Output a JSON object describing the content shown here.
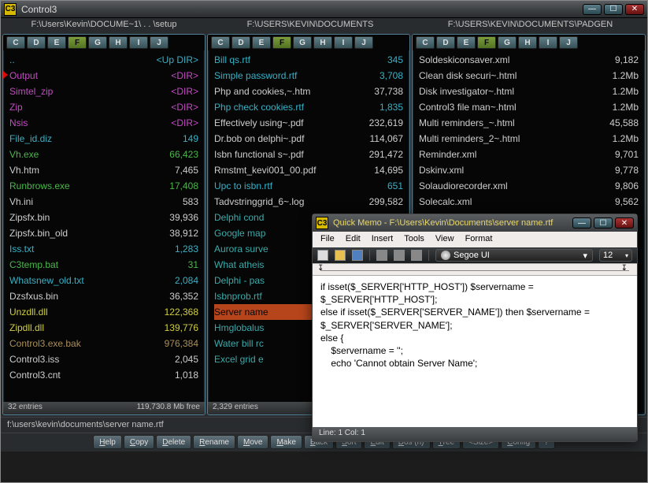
{
  "app": {
    "title": "Control3"
  },
  "paths": {
    "p1": "F:\\Users\\Kevin\\DOCUME~1\\ . . \\setup",
    "p2": "F:\\USERS\\KEVIN\\DOCUMENTS",
    "p3": "F:\\USERS\\KEVIN\\DOCUMENTS\\PADGEN"
  },
  "drives": [
    "C",
    "D",
    "E",
    "F",
    "G",
    "H",
    "I",
    "J"
  ],
  "drive_active": "F",
  "panel1": {
    "files": [
      {
        "name": "..",
        "size": "<Up DIR>",
        "c": "c-cyan"
      },
      {
        "name": "Output",
        "size": "<DIR>",
        "c": "c-mag",
        "marked": true
      },
      {
        "name": "Simtel_zip",
        "size": "<DIR>",
        "c": "c-mag"
      },
      {
        "name": "Zip",
        "size": "<DIR>",
        "c": "c-mag"
      },
      {
        "name": "Nsis",
        "size": "<DIR>",
        "c": "c-mag"
      },
      {
        "name": "File_id.diz",
        "size": "149",
        "c": "c-cyan"
      },
      {
        "name": "Vh.exe",
        "size": "66,423",
        "c": "c-green"
      },
      {
        "name": "Vh.htm",
        "size": "7,465",
        "c": "c-white"
      },
      {
        "name": "Runbrows.exe",
        "size": "17,408",
        "c": "c-green"
      },
      {
        "name": "Vh.ini",
        "size": "583",
        "c": "c-white"
      },
      {
        "name": "Zipsfx.bin",
        "size": "39,936",
        "c": "c-white"
      },
      {
        "name": "Zipsfx.bin_old",
        "size": "38,912",
        "c": "c-white"
      },
      {
        "name": "Iss.txt",
        "size": "1,283",
        "c": "c-cyan"
      },
      {
        "name": "C3temp.bat",
        "size": "31",
        "c": "c-green"
      },
      {
        "name": "Whatsnew_old.txt",
        "size": "2,084",
        "c": "c-cyan"
      },
      {
        "name": "Dzsfxus.bin",
        "size": "36,352",
        "c": "c-white"
      },
      {
        "name": "Unzdll.dll",
        "size": "122,368",
        "c": "c-yellow"
      },
      {
        "name": "Zipdll.dll",
        "size": "139,776",
        "c": "c-yellow"
      },
      {
        "name": "Control3.exe.bak",
        "size": "976,384",
        "c": "c-tan"
      },
      {
        "name": "Control3.iss",
        "size": "2,045",
        "c": "c-white"
      },
      {
        "name": "Control3.cnt",
        "size": "1,018",
        "c": "c-white"
      }
    ],
    "status_left": "32 entries",
    "status_right": "119,730.8 Mb free"
  },
  "panel2": {
    "files": [
      {
        "name": "Bill qs.rtf",
        "size": "345",
        "c": "c-cyan"
      },
      {
        "name": "Simple password.rtf",
        "size": "3,708",
        "c": "c-cyan"
      },
      {
        "name": "Php and cookies,~.htm",
        "size": "37,738",
        "c": "c-white"
      },
      {
        "name": "Php check cookies.rtf",
        "size": "1,835",
        "c": "c-cyan"
      },
      {
        "name": "Effectively using~.pdf",
        "size": "232,619",
        "c": "c-white"
      },
      {
        "name": "Dr.bob on delphi~.pdf",
        "size": "114,067",
        "c": "c-white"
      },
      {
        "name": "Isbn functional s~.pdf",
        "size": "291,472",
        "c": "c-white"
      },
      {
        "name": "Rmstmt_kevi001_00.pdf",
        "size": "14,695",
        "c": "c-white"
      },
      {
        "name": "Upc to isbn.rtf",
        "size": "651",
        "c": "c-cyan"
      },
      {
        "name": "Tadvstringgrid_6~.log",
        "size": "299,582",
        "c": "c-white"
      },
      {
        "name": "Delphi cond",
        "size": "",
        "c": "c-teal"
      },
      {
        "name": "Google map",
        "size": "",
        "c": "c-teal"
      },
      {
        "name": "Aurora surve",
        "size": "",
        "c": "c-teal"
      },
      {
        "name": "What atheis",
        "size": "",
        "c": "c-teal"
      },
      {
        "name": "Delphi - pas",
        "size": "",
        "c": "c-teal"
      },
      {
        "name": "Isbnprob.rtf",
        "size": "",
        "c": "c-teal"
      },
      {
        "name": "Server name",
        "size": "",
        "c": "c-white",
        "sel": true
      },
      {
        "name": "Hmglobalus",
        "size": "",
        "c": "c-teal"
      },
      {
        "name": "Water bill rc",
        "size": "",
        "c": "c-teal"
      },
      {
        "name": "Excel grid e",
        "size": "",
        "c": "c-teal"
      }
    ],
    "status_left": "2,329 entries",
    "status_right": ""
  },
  "panel3": {
    "files": [
      {
        "name": "Soldeskiconsaver.xml",
        "size": "9,182",
        "c": "c-white"
      },
      {
        "name": "Clean disk securi~.html",
        "size": "1.2Mb",
        "c": "c-white"
      },
      {
        "name": "Disk investigator~.html",
        "size": "1.2Mb",
        "c": "c-white"
      },
      {
        "name": "Control3 file man~.html",
        "size": "1.2Mb",
        "c": "c-white"
      },
      {
        "name": "Multi reminders_~.html",
        "size": "45,588",
        "c": "c-white"
      },
      {
        "name": "Multi reminders_2~.html",
        "size": "1.2Mb",
        "c": "c-white"
      },
      {
        "name": "Reminder.xml",
        "size": "9,701",
        "c": "c-white"
      },
      {
        "name": "Dskinv.xml",
        "size": "9,778",
        "c": "c-white"
      },
      {
        "name": "Solaudiorecorder.xml",
        "size": "9,806",
        "c": "c-white"
      },
      {
        "name": "Solecalc.xml",
        "size": "9,562",
        "c": "c-white"
      }
    ]
  },
  "curpath": "f:\\users\\kevin\\documents\\server name.rtf",
  "buttons": [
    "Help",
    "Copy",
    "Delete",
    "Rename",
    "Move",
    "Make",
    "Back",
    "Sort",
    "Edit",
    "Dos (n)",
    "Tree",
    "<Size>",
    "Config",
    "?"
  ],
  "memo": {
    "title": "Quick Memo - F:\\Users\\Kevin\\Documents\\server name.rtf",
    "menus": [
      "File",
      "Edit",
      "Insert",
      "Tools",
      "View",
      "Format"
    ],
    "font": "Segoe UI",
    "size": "12",
    "text": "if isset($_SERVER['HTTP_HOST']) $servername = $_SERVER['HTTP_HOST'];\nelse if isset($_SERVER['SERVER_NAME']) then $servername = $_SERVER['SERVER_NAME'];\nelse {\n    $servername = '';\n    echo 'Cannot obtain Server Name';",
    "status": "Line:  1 Col:  1"
  }
}
